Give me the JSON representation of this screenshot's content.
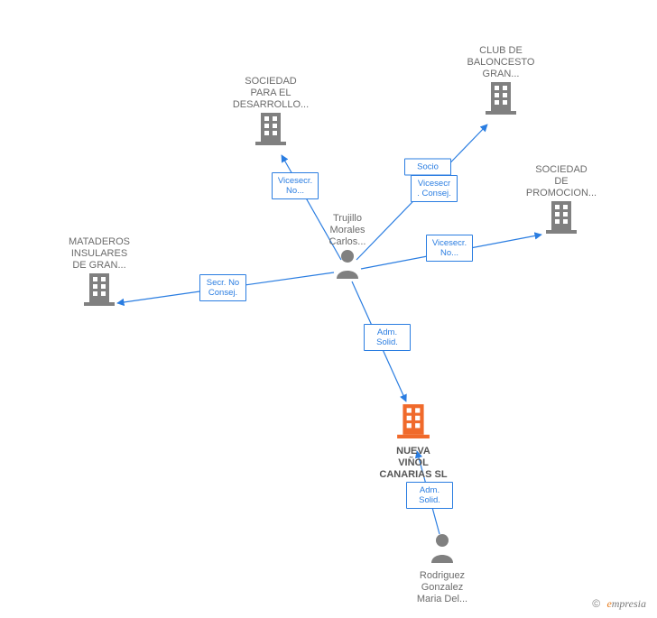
{
  "nodes": {
    "mataderos": {
      "label": "MATADEROS\nINSULARES\nDE GRAN..."
    },
    "sociedad_desarrollo": {
      "label": "SOCIEDAD\nPARA EL\nDESARROLLO..."
    },
    "club": {
      "label": "CLUB DE\nBALONCESTO\nGRAN..."
    },
    "sociedad_promocion": {
      "label": "SOCIEDAD\nDE\nPROMOCION..."
    },
    "nueva": {
      "label": "NUEVA\nVIÑOL\nCANARIAS SL"
    },
    "trujillo": {
      "label": "Trujillo\nMorales\nCarlos..."
    },
    "rodriguez": {
      "label": "Rodriguez\nGonzalez\nMaria Del..."
    }
  },
  "edges": {
    "e_secr": {
      "label": "Secr. No\nConsej."
    },
    "e_vice1": {
      "label": "Vicesecr.\nNo..."
    },
    "e_socio": {
      "label": "Socio"
    },
    "e_vice_consej": {
      "label": "Vicesecr\n. Consej."
    },
    "e_vice2": {
      "label": "Vicesecr.\nNo..."
    },
    "e_adm1": {
      "label": "Adm.\nSolid."
    },
    "e_adm2": {
      "label": "Adm.\nSolid."
    }
  },
  "colors": {
    "building_gray": "#808080",
    "building_orange": "#f06a2b",
    "person": "#808080",
    "edge": "#2a7de1"
  },
  "watermark": {
    "copy": "©",
    "brand_e": "e",
    "brand_rest": "mpresia"
  }
}
